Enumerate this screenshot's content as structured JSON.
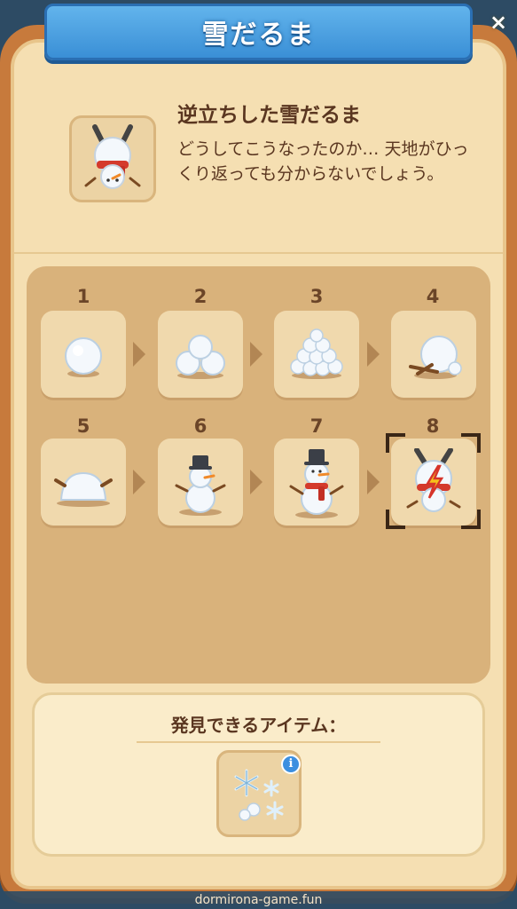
{
  "window": {
    "title": "雪だるま",
    "close_glyph": "×"
  },
  "item": {
    "name": "逆立ちした雪だるま",
    "description": "どうしてこうなったのか… 天地がひっくり返っても分からないでしょう。",
    "icon": "upside-down-snowman-icon"
  },
  "steps": [
    {
      "num": "1",
      "icon": "snowball-icon"
    },
    {
      "num": "2",
      "icon": "three-snowballs-icon"
    },
    {
      "num": "3",
      "icon": "snowball-pile-icon"
    },
    {
      "num": "4",
      "icon": "snowball-with-sticks-icon"
    },
    {
      "num": "5",
      "icon": "snow-mound-icon"
    },
    {
      "num": "6",
      "icon": "snowman-with-hat-icon"
    },
    {
      "num": "7",
      "icon": "snowman-with-scarf-icon"
    },
    {
      "num": "8",
      "icon": "upside-down-snowman-locked-icon"
    }
  ],
  "discoverable": {
    "label": "発見できるアイテム：",
    "item_icon": "snowflakes-icon",
    "info_glyph": "i"
  },
  "footer": {
    "watermark": "dormirona-game.fun"
  },
  "colors": {
    "panel": "#c77a3c",
    "panel_bg": "#f5dfb2",
    "banner": "#3a8fd6",
    "text": "#5a3620"
  }
}
